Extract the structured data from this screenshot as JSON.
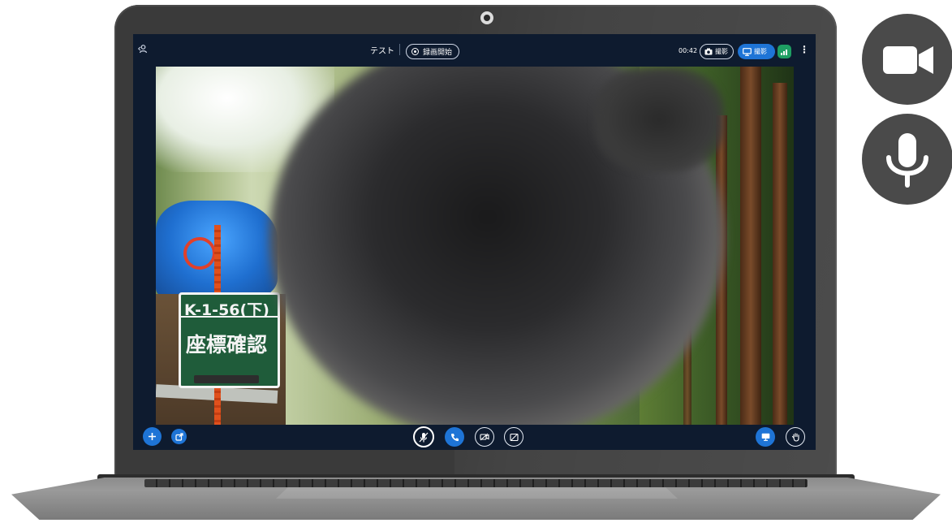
{
  "call": {
    "title": "テスト",
    "record_label": "録画開始",
    "timer": "00:42",
    "capture_label": "撮影",
    "screen_label": "撮影"
  },
  "video": {
    "sign_line1": "K-1-56(下)",
    "sign_line2": "座標確認"
  },
  "colors": {
    "screen_bg": "#0e1b2f",
    "accent_blue": "#1e74d6",
    "signal_green": "#1e9f63",
    "laptop_body": "#3a3a3a",
    "side_badge": "#4a4a4a"
  },
  "icons": {
    "topbar_left": "participants-icon",
    "record": "record-dot-icon",
    "capture": "camera-icon",
    "screen": "monitor-icon",
    "signal": "signal-strength-icon",
    "menu": "kebab-menu-icon",
    "bottom_left": [
      "add-icon",
      "external-link-icon"
    ],
    "bottom_center": [
      "mic-off-icon",
      "phone-icon",
      "video-off-icon",
      "screen-share-off-icon"
    ],
    "bottom_right": [
      "display-icon",
      "hand-icon"
    ],
    "side": [
      "video-camera-icon",
      "microphone-icon"
    ]
  }
}
